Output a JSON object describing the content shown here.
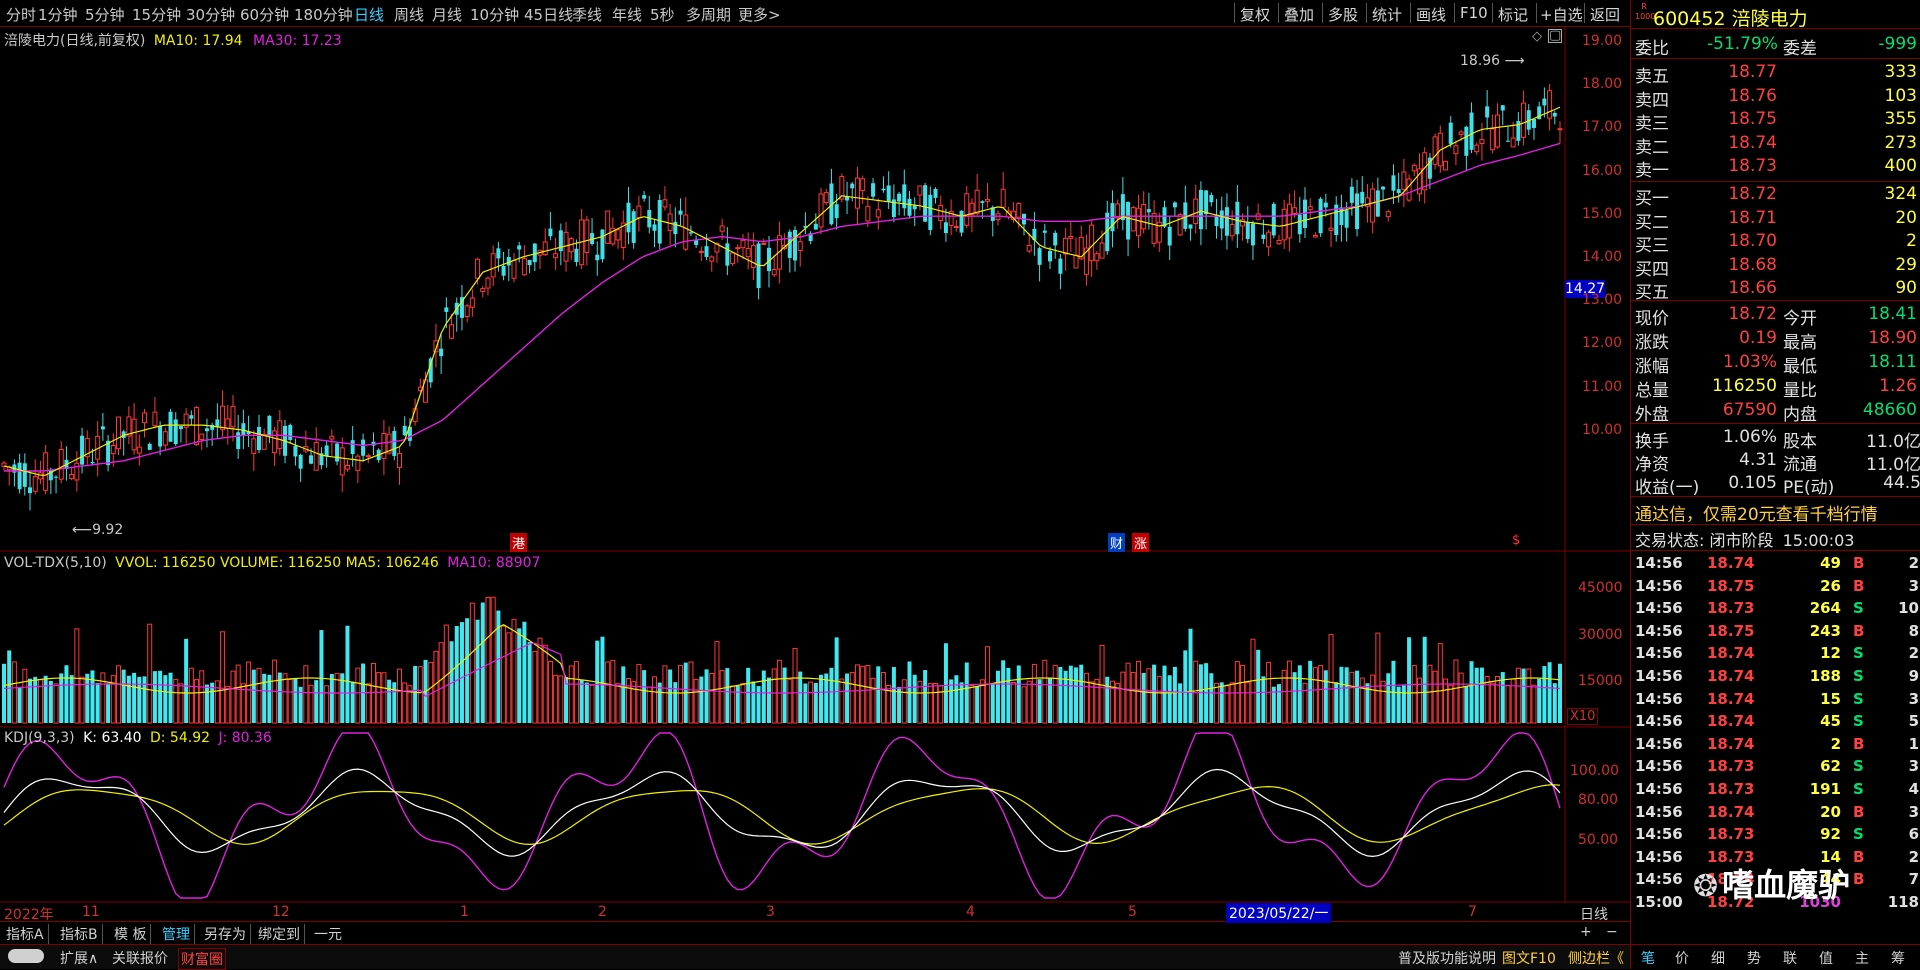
{
  "toolbar": {
    "periods": [
      "分时",
      "1分钟",
      "5分钟",
      "15分钟",
      "30分钟",
      "60分钟",
      "180分钟",
      "日线",
      "周线",
      "月线",
      "10分钟",
      "45日线",
      "季线",
      "年线",
      "5秒",
      "多周期",
      "更多>"
    ],
    "actions": [
      "复权",
      "叠加",
      "多股",
      "统计",
      "画线",
      "F10",
      "标记",
      "+自选",
      "返回"
    ]
  },
  "chart": {
    "title": "涪陵电力(日线,前复权)",
    "ma10_label": "MA10: 17.94",
    "ma30_label": "MA30: 17.23",
    "high_marker": "18.96",
    "low_marker": "9.92",
    "current_price_tag": "14.27",
    "event_labels": [
      "港",
      "财",
      "涨",
      "$"
    ],
    "price_axis": [
      "19.00",
      "18.00",
      "17.00",
      "16.00",
      "15.00",
      "14.00",
      "13.00",
      "12.00",
      "11.00",
      "10.00"
    ],
    "volume_title": "VOL-TDX(5,10)",
    "volume_values": "VVOL: 116250  VOLUME: 116250  MA5: 106246",
    "volume_ma10": "MA10: 88907",
    "volume_axis": [
      "45000",
      "30000",
      "15000"
    ],
    "volume_unit": "X10",
    "kdj_title": "KDJ(9,3,3)",
    "kdj_k": "K: 63.40",
    "kdj_d": "D: 54.92",
    "kdj_j": "J: 80.36",
    "kdj_axis": [
      "100.00",
      "80.00",
      "50.00"
    ],
    "date_labels": [
      "2022年",
      "11",
      "12",
      "1",
      "2",
      "3",
      "4",
      "5",
      "7"
    ],
    "date_highlight": "2023/05/22/一",
    "period_label": "日线"
  },
  "chart_data": {
    "type": "line",
    "series": [
      {
        "name": "MA10",
        "y": [
          10.9,
          10.7,
          11.1,
          11.5,
          11.7,
          11.7,
          11.6,
          11.4,
          11.1,
          11.0,
          11.3,
          13.6,
          14.7,
          15.0,
          15.2,
          15.4,
          15.8,
          15.6,
          15.2,
          14.8,
          15.5,
          16.2,
          16.1,
          16.0,
          15.8,
          16.0,
          15.2,
          15.0,
          15.8,
          15.6,
          15.9,
          15.7,
          15.6,
          15.8,
          16.0,
          16.2,
          17.1,
          17.5,
          17.6,
          17.94
        ]
      },
      {
        "name": "MA30",
        "y": [
          10.8,
          10.8,
          10.9,
          11.0,
          11.2,
          11.4,
          11.5,
          11.5,
          11.4,
          11.3,
          11.4,
          11.8,
          12.5,
          13.2,
          13.9,
          14.5,
          15.0,
          15.3,
          15.4,
          15.3,
          15.4,
          15.6,
          15.7,
          15.8,
          15.8,
          15.8,
          15.7,
          15.7,
          15.8,
          15.8,
          15.8,
          15.8,
          15.8,
          15.9,
          16.0,
          16.2,
          16.5,
          16.8,
          17.0,
          17.23
        ]
      }
    ],
    "ylim": [
      9.7,
      19.2
    ]
  },
  "quote": {
    "badge_top": "R",
    "badge_bottom": "1000",
    "code": "600452",
    "name": "涪陵电力",
    "weibi_label": "委比",
    "weibi_value": "-51.79%",
    "weicha_label": "委差",
    "weicha_value": "-999",
    "asks": [
      {
        "label": "卖五",
        "price": "18.77",
        "vol": "333"
      },
      {
        "label": "卖四",
        "price": "18.76",
        "vol": "103"
      },
      {
        "label": "卖三",
        "price": "18.75",
        "vol": "355"
      },
      {
        "label": "卖二",
        "price": "18.74",
        "vol": "273"
      },
      {
        "label": "卖一",
        "price": "18.73",
        "vol": "400"
      }
    ],
    "bids": [
      {
        "label": "买一",
        "price": "18.72",
        "vol": "324"
      },
      {
        "label": "买二",
        "price": "18.71",
        "vol": "20"
      },
      {
        "label": "买三",
        "price": "18.70",
        "vol": "2"
      },
      {
        "label": "买四",
        "price": "18.68",
        "vol": "29"
      },
      {
        "label": "买五",
        "price": "18.66",
        "vol": "90"
      }
    ],
    "stats": [
      {
        "l1": "现价",
        "v1": "18.72",
        "c1": "red",
        "l2": "今开",
        "v2": "18.41",
        "c2": "green"
      },
      {
        "l1": "涨跌",
        "v1": "0.19",
        "c1": "red",
        "l2": "最高",
        "v2": "18.90",
        "c2": "red"
      },
      {
        "l1": "涨幅",
        "v1": "1.03%",
        "c1": "red",
        "l2": "最低",
        "v2": "18.11",
        "c2": "green"
      },
      {
        "l1": "总量",
        "v1": "116250",
        "c1": "yellow",
        "l2": "量比",
        "v2": "1.26",
        "c2": "red"
      },
      {
        "l1": "外盘",
        "v1": "67590",
        "c1": "red",
        "l2": "内盘",
        "v2": "48660",
        "c2": "green"
      }
    ],
    "stats2": [
      {
        "l1": "换手",
        "v1": "1.06%",
        "l2": "股本",
        "v2": "11.0亿"
      },
      {
        "l1": "净资",
        "v1": "4.31",
        "l2": "流通",
        "v2": "11.0亿"
      },
      {
        "l1": "收益(一)",
        "v1": "0.105",
        "l2": "PE(动)",
        "v2": "44.5"
      }
    ],
    "promo": "通达信，仅需20元查看千档行情",
    "trade_status_label": "交易状态:",
    "trade_status_value": "闭市阶段",
    "trade_time": "15:00:03",
    "ticks": [
      {
        "t": "14:56",
        "p": "18.74",
        "v": "49",
        "s": "B",
        "n": "2"
      },
      {
        "t": "14:56",
        "p": "18.75",
        "v": "26",
        "s": "B",
        "n": "3"
      },
      {
        "t": "14:56",
        "p": "18.73",
        "v": "264",
        "s": "S",
        "n": "10"
      },
      {
        "t": "14:56",
        "p": "18.75",
        "v": "243",
        "s": "B",
        "n": "8"
      },
      {
        "t": "14:56",
        "p": "18.74",
        "v": "12",
        "s": "S",
        "n": "2"
      },
      {
        "t": "14:56",
        "p": "18.74",
        "v": "188",
        "s": "S",
        "n": "9"
      },
      {
        "t": "14:56",
        "p": "18.74",
        "v": "15",
        "s": "S",
        "n": "3"
      },
      {
        "t": "14:56",
        "p": "18.74",
        "v": "45",
        "s": "S",
        "n": "5"
      },
      {
        "t": "14:56",
        "p": "18.74",
        "v": "2",
        "s": "B",
        "n": "1"
      },
      {
        "t": "14:56",
        "p": "18.73",
        "v": "62",
        "s": "S",
        "n": "3"
      },
      {
        "t": "14:56",
        "p": "18.73",
        "v": "191",
        "s": "S",
        "n": "4"
      },
      {
        "t": "14:56",
        "p": "18.74",
        "v": "20",
        "s": "B",
        "n": "3"
      },
      {
        "t": "14:56",
        "p": "18.73",
        "v": "92",
        "s": "S",
        "n": "6"
      },
      {
        "t": "14:56",
        "p": "18.73",
        "v": "14",
        "s": "B",
        "n": "2"
      },
      {
        "t": "14:56",
        "p": "18.74",
        "v": "44",
        "s": "B",
        "n": "7"
      },
      {
        "t": "15:00",
        "p": "18.72",
        "v": "1030",
        "s": "",
        "n": "118"
      }
    ],
    "bottom_tabs": [
      "笔",
      "价",
      "细",
      "势",
      "联",
      "值",
      "主",
      "筹"
    ],
    "watermark": "嗜血魔驴"
  },
  "bottom_bar": {
    "row1": [
      "指标A",
      "指标B",
      "模 板",
      "管理",
      "另存为",
      "绑定到",
      "一元"
    ],
    "row2": [
      "扩展∧",
      "关联报价",
      "财富圈"
    ],
    "right_links": [
      "普及版功能说明",
      "图文F10",
      "侧边栏《"
    ]
  }
}
